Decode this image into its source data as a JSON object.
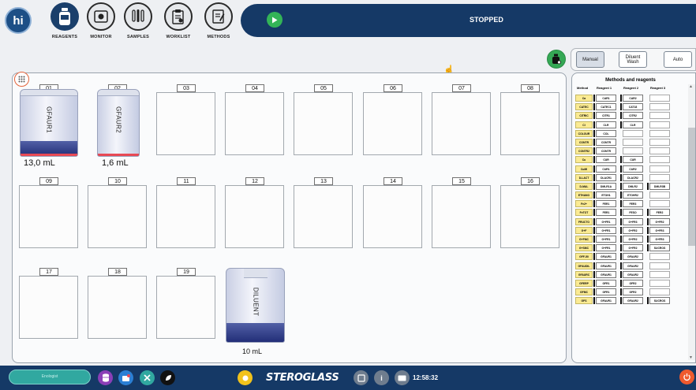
{
  "nav": {
    "logo": "hi",
    "buttons": [
      {
        "label": "REAGENTS",
        "icon": "reagent-bottle-icon",
        "active": true
      },
      {
        "label": "MONITOR",
        "icon": "monitor-icon",
        "active": false
      },
      {
        "label": "SAMPLES",
        "icon": "samples-icon",
        "active": false
      },
      {
        "label": "WORKLIST",
        "icon": "worklist-icon",
        "active": false
      },
      {
        "label": "METHODS",
        "icon": "methods-icon",
        "active": false
      }
    ]
  },
  "run": {
    "status": "STOPPED"
  },
  "mode": {
    "manual": "Manual",
    "diluent_wash": "Diluent Wash",
    "auto": "Auto"
  },
  "slots": [
    {
      "num": "01",
      "bottle": "GFAUR1",
      "volume": "13,0 mL",
      "fill": 0.22,
      "stripe": "#e84a55"
    },
    {
      "num": "02",
      "bottle": "GFAUR2",
      "volume": "1,6 mL",
      "fill": 0.04,
      "stripe": "#e84a55"
    },
    {
      "num": "03"
    },
    {
      "num": "04"
    },
    {
      "num": "05"
    },
    {
      "num": "06"
    },
    {
      "num": "07"
    },
    {
      "num": "08"
    },
    {
      "num": "09"
    },
    {
      "num": "10"
    },
    {
      "num": "11"
    },
    {
      "num": "12"
    },
    {
      "num": "13"
    },
    {
      "num": "14"
    },
    {
      "num": "15"
    },
    {
      "num": "16"
    },
    {
      "num": "17"
    },
    {
      "num": "18"
    },
    {
      "num": "19"
    }
  ],
  "diluent": {
    "label": "DILUENT",
    "volume": "10 mL",
    "fill": 0.25
  },
  "methods_panel": {
    "title": "Methods and reagents",
    "headers": [
      "Method",
      "Reagent 1",
      "Reagent 2",
      "Reagent 3"
    ],
    "rows": [
      [
        "Ca",
        "CAR1",
        "CAR2",
        ""
      ],
      [
        "CATEC",
        "CATEC1",
        "CAT18",
        ""
      ],
      [
        "CITRIC",
        "CITR1",
        "CITR2",
        ""
      ],
      [
        "Cl",
        "CLR",
        "CLR",
        ""
      ],
      [
        "COLOUR",
        "COL",
        "",
        ""
      ],
      [
        "CONTR",
        "CONTR",
        "",
        ""
      ],
      [
        "CONTR2",
        "CONTR",
        "",
        ""
      ],
      [
        "Cu",
        "CUR",
        "CUR",
        ""
      ],
      [
        "CuMI",
        "CUR1",
        "CUR2",
        ""
      ],
      [
        "D-LACT",
        "DLACR1",
        "DLACR2",
        ""
      ],
      [
        "D-MAL",
        "DMLR1A",
        "DMLR2",
        "DMLR3B"
      ],
      [
        "ETHANO",
        "ETOH1",
        "ETOHR2",
        ""
      ],
      [
        "Fe2+",
        "FER1",
        "FER3",
        ""
      ],
      [
        "FeTOT",
        "FER1",
        "FESO",
        "FER2"
      ],
      [
        "FRUCTO",
        "G+FR1",
        "G+FR3",
        "G+FR2"
      ],
      [
        "G+F",
        "G+FR1",
        "G+FR2",
        "G+FR3"
      ],
      [
        "G+FMC",
        "G+FR1",
        "G+FR2",
        "G+FR3"
      ],
      [
        "G+SMC",
        "G+FR1",
        "G+FR2",
        "SUCROS"
      ],
      [
        "GFF-50",
        "GFAUR1",
        "GFAUR2",
        ""
      ],
      [
        "GFAUDIL",
        "GFAUR1",
        "GFAUR2",
        ""
      ],
      [
        "GFAURC",
        "GFAUR1",
        "GFAUR2",
        ""
      ],
      [
        "GFERP",
        "GFR1",
        "GFR2",
        ""
      ],
      [
        "GFMC",
        "GFR1",
        "GFR2",
        ""
      ],
      [
        "GFS",
        "GFAUR1",
        "GFAUR2",
        "SUCROS"
      ]
    ]
  },
  "footer": {
    "user": "Enologist",
    "brand": "STEROGLASS",
    "clock": "12:58:32",
    "colors": {
      "accent": "#153966",
      "teal": "#31a8a0",
      "power": "#ef5a2e"
    }
  }
}
